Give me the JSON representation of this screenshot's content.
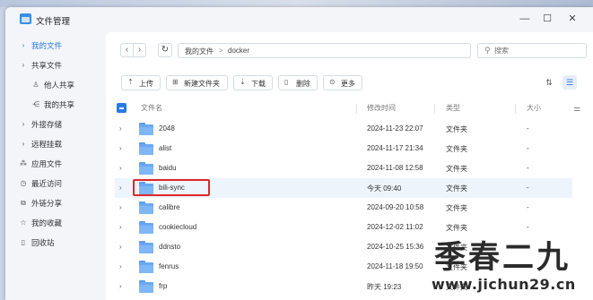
{
  "window": {
    "title": "文件管理",
    "minimize_icon": "minimize-icon",
    "maximize_icon": "maximize-icon",
    "close_icon": "close-icon"
  },
  "sidebar": {
    "items": [
      {
        "label": "我的文件",
        "icon": "chevron-right-icon",
        "active": true
      },
      {
        "label": "共享文件",
        "icon": "chevron-right-icon"
      },
      {
        "label": "他人共享",
        "icon": "person-icon"
      },
      {
        "label": "我的共享",
        "icon": "share-icon"
      },
      {
        "label": "外接存储",
        "icon": "chevron-right-icon"
      },
      {
        "label": "远程挂载",
        "icon": "chevron-right-icon"
      },
      {
        "label": "应用文件",
        "icon": "apps-icon"
      },
      {
        "label": "最近访问",
        "icon": "clock-icon"
      },
      {
        "label": "外链分享",
        "icon": "link-icon"
      },
      {
        "label": "我的收藏",
        "icon": "star-icon"
      },
      {
        "label": "回收站",
        "icon": "trash-icon"
      }
    ],
    "accent_color": "#2a7ae2"
  },
  "nav": {
    "back_icon": "chevron-left-icon",
    "forward_icon": "chevron-right-icon",
    "refresh_icon": "refresh-icon",
    "breadcrumb": [
      "我的文件",
      "docker"
    ],
    "separator": ">"
  },
  "search": {
    "placeholder": "搜索"
  },
  "toolbar": {
    "upload": "上传",
    "new_folder": "新建文件夹",
    "download": "下载",
    "delete": "删除",
    "more": "更多"
  },
  "table": {
    "columns": [
      "文件名",
      "修改时间",
      "类型",
      "大小"
    ],
    "rows": [
      {
        "name": "2048",
        "date": "2024-11-23 22:07",
        "type": "文件夹",
        "size": "-"
      },
      {
        "name": "alist",
        "date": "2024-11-17 21:34",
        "type": "文件夹",
        "size": "-"
      },
      {
        "name": "baidu",
        "date": "2024-11-08 12:58",
        "type": "文件夹",
        "size": "-"
      },
      {
        "name": "bili-sync",
        "date": "今天 09:40",
        "type": "文件夹",
        "size": "-",
        "highlighted": true
      },
      {
        "name": "calibre",
        "date": "2024-09-20 10:58",
        "type": "文件夹",
        "size": "-"
      },
      {
        "name": "cookiecloud",
        "date": "2024-12-02 11:02",
        "type": "文件夹",
        "size": "-"
      },
      {
        "name": "ddnsto",
        "date": "2024-10-25 15:36",
        "type": "文件夹",
        "size": "-"
      },
      {
        "name": "fenrus",
        "date": "2024-11-18 19:50",
        "type": "文件夹",
        "size": "-"
      },
      {
        "name": "frp",
        "date": "昨天 19:23",
        "type": "文件夹",
        "size": "-"
      }
    ]
  },
  "watermark": {
    "title": "季春二九",
    "url": "www.jichun29.cn"
  }
}
